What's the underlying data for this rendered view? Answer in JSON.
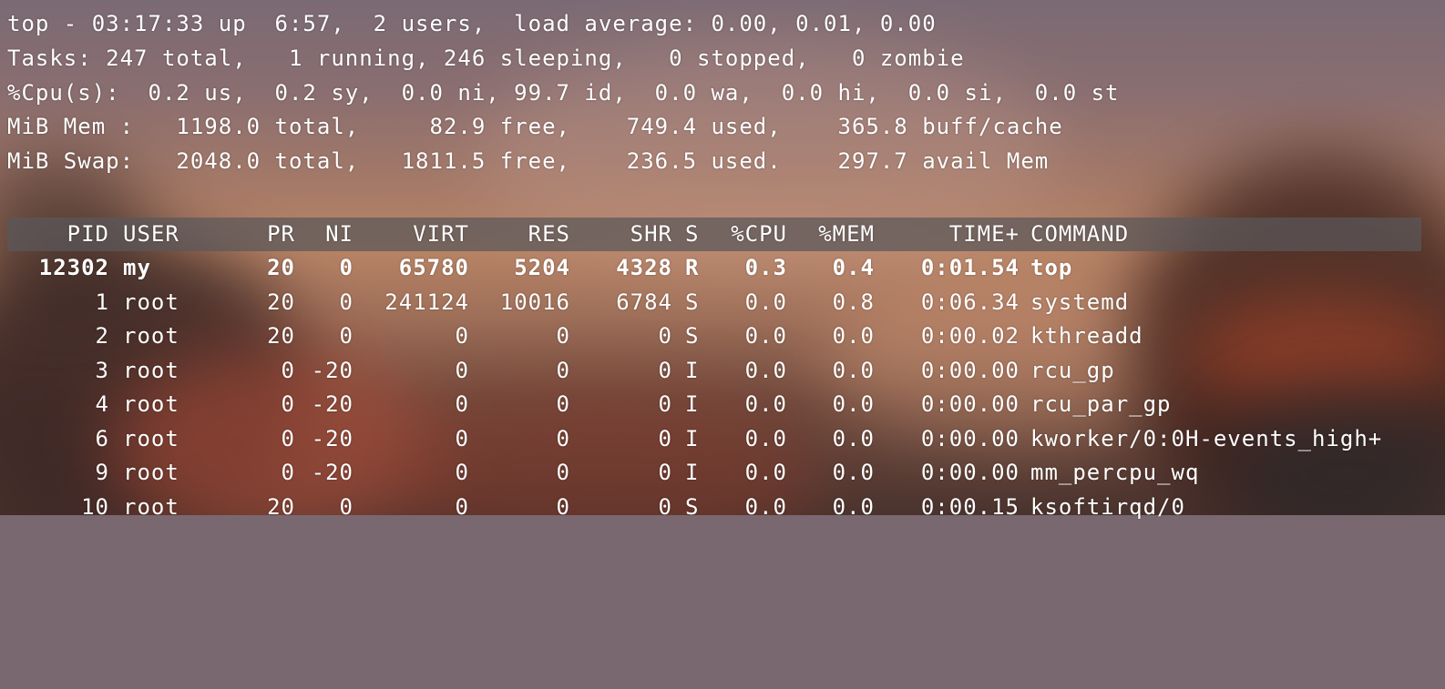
{
  "summary": {
    "line1": "top - 03:17:33 up  6:57,  2 users,  load average: 0.00, 0.01, 0.00",
    "line2": "Tasks: 247 total,   1 running, 246 sleeping,   0 stopped,   0 zombie",
    "line3": "%Cpu(s):  0.2 us,  0.2 sy,  0.0 ni, 99.7 id,  0.0 wa,  0.0 hi,  0.0 si,  0.0 st",
    "line4": "MiB Mem :   1198.0 total,     82.9 free,    749.4 used,    365.8 buff/cache",
    "line5": "MiB Swap:   2048.0 total,   1811.5 free,    236.5 used.    297.7 avail Mem"
  },
  "table": {
    "headers": {
      "pid": "PID",
      "user": "USER",
      "pr": "PR",
      "ni": "NI",
      "virt": "VIRT",
      "res": "RES",
      "shr": "SHR",
      "s": "S",
      "cpu": "%CPU",
      "mem": "%MEM",
      "time": "TIME+",
      "command": "COMMAND"
    },
    "rows": [
      {
        "pid": "12302",
        "user": "my",
        "pr": "20",
        "ni": "0",
        "virt": "65780",
        "res": "5204",
        "shr": "4328",
        "s": "R",
        "cpu": "0.3",
        "mem": "0.4",
        "time": "0:01.54",
        "command": "top"
      },
      {
        "pid": "1",
        "user": "root",
        "pr": "20",
        "ni": "0",
        "virt": "241124",
        "res": "10016",
        "shr": "6784",
        "s": "S",
        "cpu": "0.0",
        "mem": "0.8",
        "time": "0:06.34",
        "command": "systemd"
      },
      {
        "pid": "2",
        "user": "root",
        "pr": "20",
        "ni": "0",
        "virt": "0",
        "res": "0",
        "shr": "0",
        "s": "S",
        "cpu": "0.0",
        "mem": "0.0",
        "time": "0:00.02",
        "command": "kthreadd"
      },
      {
        "pid": "3",
        "user": "root",
        "pr": "0",
        "ni": "-20",
        "virt": "0",
        "res": "0",
        "shr": "0",
        "s": "I",
        "cpu": "0.0",
        "mem": "0.0",
        "time": "0:00.00",
        "command": "rcu_gp"
      },
      {
        "pid": "4",
        "user": "root",
        "pr": "0",
        "ni": "-20",
        "virt": "0",
        "res": "0",
        "shr": "0",
        "s": "I",
        "cpu": "0.0",
        "mem": "0.0",
        "time": "0:00.00",
        "command": "rcu_par_gp"
      },
      {
        "pid": "6",
        "user": "root",
        "pr": "0",
        "ni": "-20",
        "virt": "0",
        "res": "0",
        "shr": "0",
        "s": "I",
        "cpu": "0.0",
        "mem": "0.0",
        "time": "0:00.00",
        "command": "kworker/0:0H-events_high+"
      },
      {
        "pid": "9",
        "user": "root",
        "pr": "0",
        "ni": "-20",
        "virt": "0",
        "res": "0",
        "shr": "0",
        "s": "I",
        "cpu": "0.0",
        "mem": "0.0",
        "time": "0:00.00",
        "command": "mm_percpu_wq"
      },
      {
        "pid": "10",
        "user": "root",
        "pr": "20",
        "ni": "0",
        "virt": "0",
        "res": "0",
        "shr": "0",
        "s": "S",
        "cpu": "0.0",
        "mem": "0.0",
        "time": "0:00.15",
        "command": "ksoftirqd/0"
      }
    ]
  }
}
